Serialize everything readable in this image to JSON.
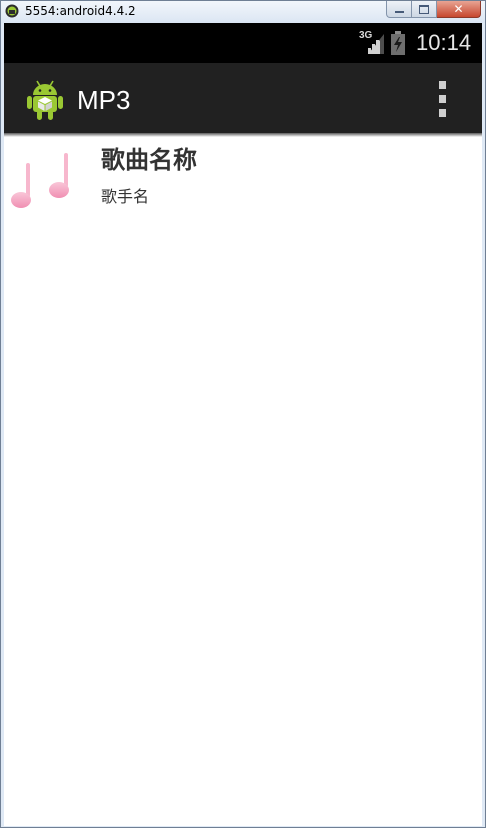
{
  "window": {
    "title": "5554:android4.4.2",
    "close_glyph": "✕"
  },
  "status_bar": {
    "network_type": "3G",
    "time": "10:14",
    "icons": [
      "signal-icon",
      "battery-charging-icon"
    ]
  },
  "action_bar": {
    "title": "MP3",
    "icons": [
      "android-app-icon",
      "overflow-menu-icon"
    ]
  },
  "songs": [
    {
      "title": "歌曲名称",
      "artist": "歌手名",
      "icon": "music-note-icon"
    }
  ],
  "colors": {
    "status_bar_bg": "#000000",
    "action_bar_bg": "#212121",
    "android_green": "#9ac833",
    "note_pink": "#f4a8c4",
    "text_dark": "#333333"
  }
}
